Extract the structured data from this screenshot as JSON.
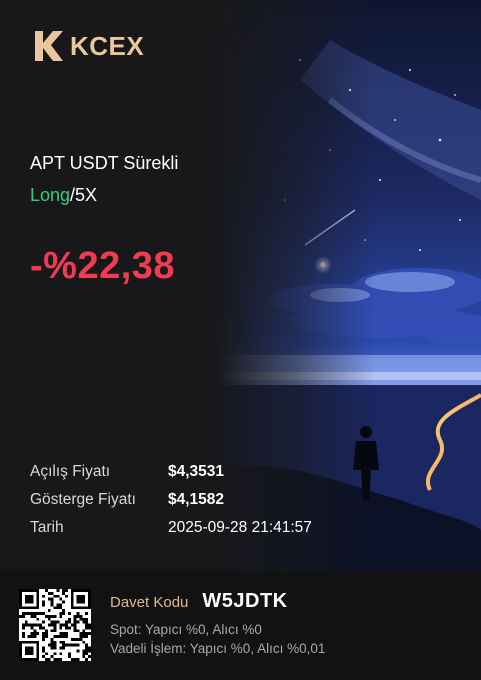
{
  "brand": {
    "name": "KCEX",
    "logo_icon": "kcex-k-logo-icon",
    "accent_color": "#e9c79d"
  },
  "position": {
    "pair": "APT USDT Sürekli",
    "side": "Long",
    "leverage": "/5X",
    "pnl": "-%22,38",
    "side_color": "#2bd17e",
    "pnl_color": "#f23a53"
  },
  "details": {
    "open_price_label": "Açılış Fiyatı",
    "open_price_value": "$4,3531",
    "mark_price_label": "Gösterge Fiyatı",
    "mark_price_value": "$4,1582",
    "date_label": "Tarih",
    "date_value": "2025-09-28 21:41:57"
  },
  "footer": {
    "invite_label": "Davet Kodu",
    "invite_code": "W5JDTK",
    "spot_fee": "Spot: Yapıcı %0, Alıcı %0",
    "futures_fee": "Vadeli İşlem: Yapıcı %0, Alıcı %0,01",
    "qr_icon": "qr-code-icon"
  }
}
